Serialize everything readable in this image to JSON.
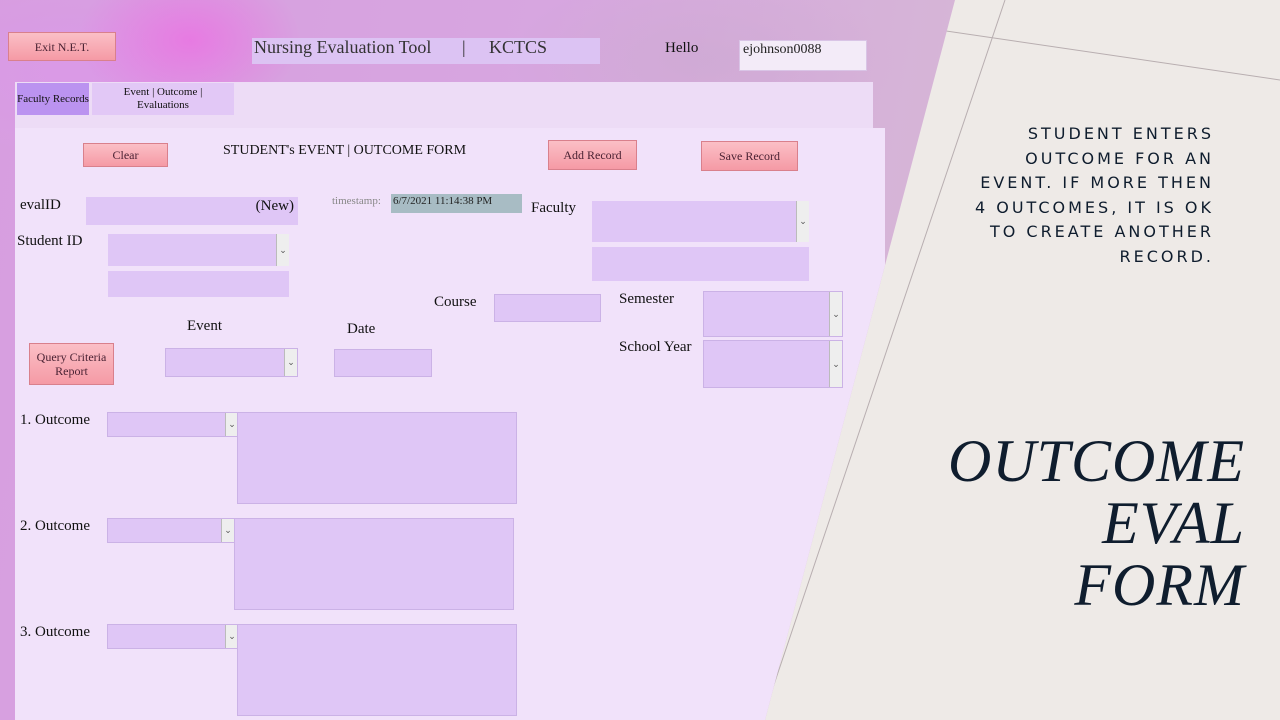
{
  "app": {
    "title": "Nursing Evaluation Tool",
    "separator": "|",
    "org": "KCTCS",
    "exit_label": "Exit N.E.T.",
    "hello_label": "Hello",
    "username": "ejohnson0088"
  },
  "tabs": [
    {
      "label": "Faculty Records",
      "active": true
    },
    {
      "label": "Event | Outcome | Evaluations",
      "active": false
    }
  ],
  "form": {
    "heading": "STUDENT's  EVENT | OUTCOME FORM",
    "clear_label": "Clear",
    "add_label": "Add Record",
    "save_label": "Save Record",
    "query_label": "Query Criteria Report",
    "evalid_label": "evalID",
    "evalid_value": "(New)",
    "timestamp_label": "timestamp:",
    "timestamp_value": "6/7/2021 11:14:38 PM",
    "faculty_label": "Faculty",
    "student_id_label": "Student ID",
    "course_label": "Course",
    "semester_label": "Semester",
    "school_year_label": "School Year",
    "event_label": "Event",
    "date_label": "Date",
    "outcomes": [
      {
        "label": "1. Outcome"
      },
      {
        "label": "2. Outcome"
      },
      {
        "label": "3. Outcome"
      }
    ]
  },
  "slide": {
    "description": "STUDENT ENTERS OUTCOME FOR AN EVENT.  IF MORE THEN 4 OUTCOMES, IT IS OK TO CREATE ANOTHER RECORD.",
    "title_lines": [
      "OUTCOME",
      "EVAL",
      "FORM"
    ]
  },
  "colors": {
    "accent_button": "#f59aa5",
    "field_fill": "#dfc6f6",
    "active_tab": "#bb93f0",
    "timestamp_fill": "#a8bcc4",
    "slide_text": "#0f1d2e"
  }
}
